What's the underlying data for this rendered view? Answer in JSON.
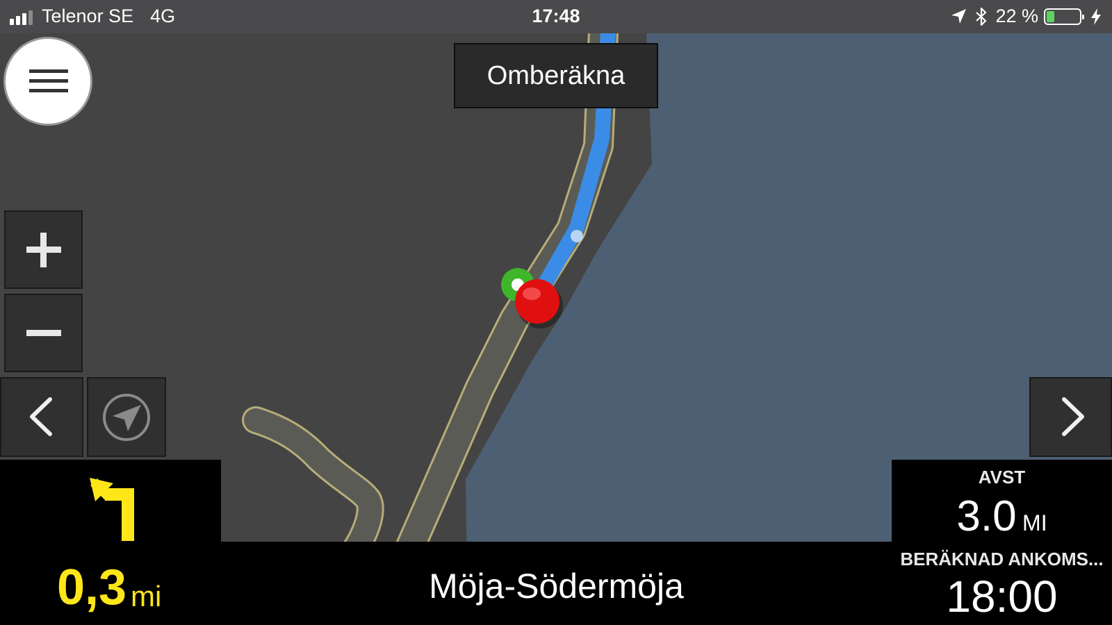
{
  "status_bar": {
    "carrier": "Telenor SE",
    "network": "4G",
    "time": "17:48",
    "battery_percent": "22 %",
    "battery_level": 0.22,
    "icons": [
      "signal-icon",
      "location-arrow-icon",
      "bluetooth-icon",
      "battery-icon",
      "charging-icon"
    ]
  },
  "top": {
    "menu_icon": "hamburger-menu-icon",
    "recalculate_label": "Omberäkna"
  },
  "map_controls": {
    "zoom_in_icon": "plus-icon",
    "zoom_out_icon": "minus-icon",
    "previous_icon": "chevron-left-icon",
    "compass_icon": "compass-icon",
    "next_icon": "chevron-right-icon"
  },
  "maneuver": {
    "arrow_icon": "turn-left-arrow-icon",
    "distance_value": "0,3",
    "distance_unit": "mi"
  },
  "street": {
    "name": "Möja-Södermöja"
  },
  "trip_info": {
    "distance_label": "AVST",
    "distance_value": "3.0",
    "distance_unit": "MI",
    "eta_label": "BERÄKNAD ANKOMS...",
    "eta_value": "18:00"
  },
  "colors": {
    "land": "#444444",
    "water": "#4d5f72",
    "road": "#5b5b56",
    "road_edge": "#b7ad78",
    "route": "#3b8ce6",
    "maneuver_accent": "#ffe619",
    "position_marker": "#e01010",
    "start_marker": "#3fb52a"
  }
}
